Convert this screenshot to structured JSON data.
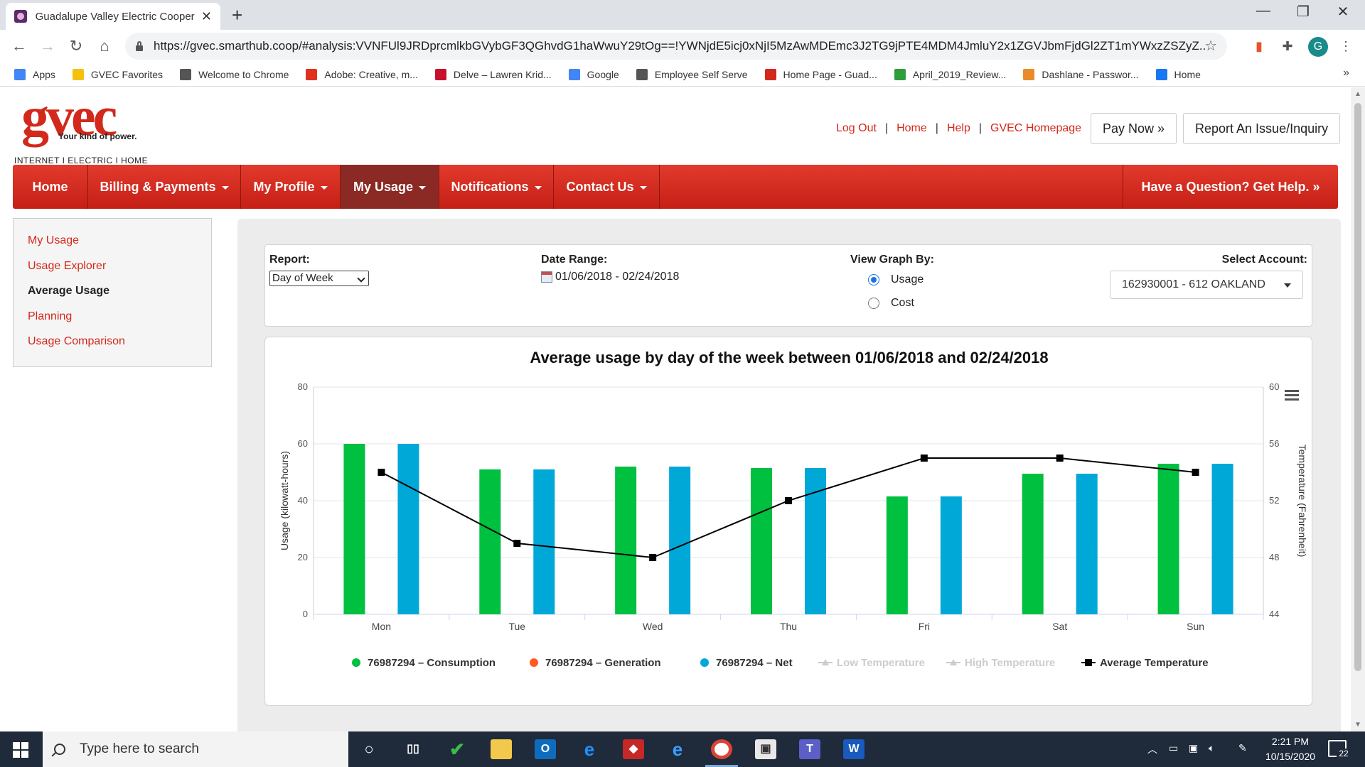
{
  "browser": {
    "tab_title": "Guadalupe Valley Electric Cooper",
    "url": "https://gvec.smarthub.coop/#analysis:VVNFUl9JRDprcmlkbGVybGF3QGhvdG1haWwuY29tOg==!YWNjdE5icj0xNjI5MzAwMDEmc3J2TG9jPTE4MDM4JmluY2x1ZGVJbmFjdGl2ZT1mYWxzZSZyZ...",
    "profile_initial": "G",
    "bookmarks": [
      {
        "label": "Apps",
        "color": "#4285f4"
      },
      {
        "label": "GVEC Favorites",
        "color": "#f4c20d"
      },
      {
        "label": "Welcome to Chrome",
        "color": "#555555"
      },
      {
        "label": "Adobe: Creative, m...",
        "color": "#e0301e"
      },
      {
        "label": "Delve – Lawren Krid...",
        "color": "#c8102e"
      },
      {
        "label": "Google",
        "color": "#4285f4"
      },
      {
        "label": "Employee Self Serve",
        "color": "#555555"
      },
      {
        "label": "Home Page - Guad...",
        "color": "#d3281c"
      },
      {
        "label": "April_2019_Review...",
        "color": "#2e9e3a"
      },
      {
        "label": "Dashlane - Passwor...",
        "color": "#e98b2a"
      },
      {
        "label": "Home",
        "color": "#1877f2"
      }
    ]
  },
  "header": {
    "logo_text": "gvec",
    "tagline": "Your kind of power.",
    "subline": "INTERNET  I  ELECTRIC  I  HOME",
    "links": [
      "Log Out",
      "Home",
      "Help",
      "GVEC Homepage"
    ],
    "pay_now": "Pay Now »",
    "report_issue": "Report An Issue/Inquiry"
  },
  "nav": {
    "items": [
      "Home",
      "Billing & Payments",
      "My Profile",
      "My Usage",
      "Notifications",
      "Contact Us"
    ],
    "help": "Have a Question? Get Help. »"
  },
  "sidebar": {
    "items": [
      "My Usage",
      "Usage Explorer",
      "Average Usage",
      "Planning",
      "Usage Comparison"
    ],
    "current_index": 2
  },
  "filters": {
    "report_label": "Report:",
    "report_value": "Day of Week",
    "date_label": "Date Range:",
    "date_value": "01/06/2018 - 02/24/2018",
    "view_label": "View Graph By:",
    "view_options": [
      "Usage",
      "Cost"
    ],
    "view_selected": "Usage",
    "account_label": "Select Account:",
    "account_value": "162930001 - 612 OAKLAND"
  },
  "chart_data": {
    "type": "bar",
    "title": "Average usage by day of the week between 01/06/2018 and 02/24/2018",
    "categories": [
      "Mon",
      "Tue",
      "Wed",
      "Thu",
      "Fri",
      "Sat",
      "Sun"
    ],
    "ylabel": "Usage (kilowatt-hours)",
    "ylim": [
      0,
      80
    ],
    "yticks": [
      0,
      20,
      40,
      60,
      80
    ],
    "y2label": "Temperature (Fahrenheit)",
    "y2lim": [
      44,
      60
    ],
    "y2ticks": [
      44,
      48,
      52,
      56,
      60
    ],
    "series": [
      {
        "name": "76987294 – Consumption",
        "color": "#00c040",
        "values": [
          60,
          51,
          52,
          51.5,
          41.5,
          49.5,
          53
        ]
      },
      {
        "name": "76987294 – Generation",
        "color": "#ff5a1f",
        "values": [
          0,
          0,
          0,
          0,
          0,
          0,
          0
        ]
      },
      {
        "name": "76987294 – Net",
        "color": "#00a8d8",
        "values": [
          60,
          51,
          52,
          51.5,
          41.5,
          49.5,
          53
        ]
      }
    ],
    "line_series": [
      {
        "name": "Average Temperature",
        "color": "#000000",
        "axis": "right",
        "values": [
          54,
          49,
          48,
          52,
          55,
          55,
          54
        ]
      }
    ],
    "legend": [
      {
        "label": "76987294 – Consumption",
        "color": "#00c040",
        "marker": "circle",
        "muted": false
      },
      {
        "label": "76987294 – Generation",
        "color": "#ff5a1f",
        "marker": "circle",
        "muted": false
      },
      {
        "label": "76987294 – Net",
        "color": "#00a8d8",
        "marker": "circle",
        "muted": false
      },
      {
        "label": "Low Temperature",
        "color": "#cccccc",
        "marker": "line",
        "muted": true
      },
      {
        "label": "High Temperature",
        "color": "#cccccc",
        "marker": "line",
        "muted": true
      },
      {
        "label": "Average Temperature",
        "color": "#000000",
        "marker": "square",
        "muted": false
      }
    ],
    "legend_position": "bottom",
    "grid": true
  },
  "taskbar": {
    "search_placeholder": "Type here to search",
    "time": "2:21 PM",
    "date": "10/15/2020",
    "notification_count": "22"
  }
}
